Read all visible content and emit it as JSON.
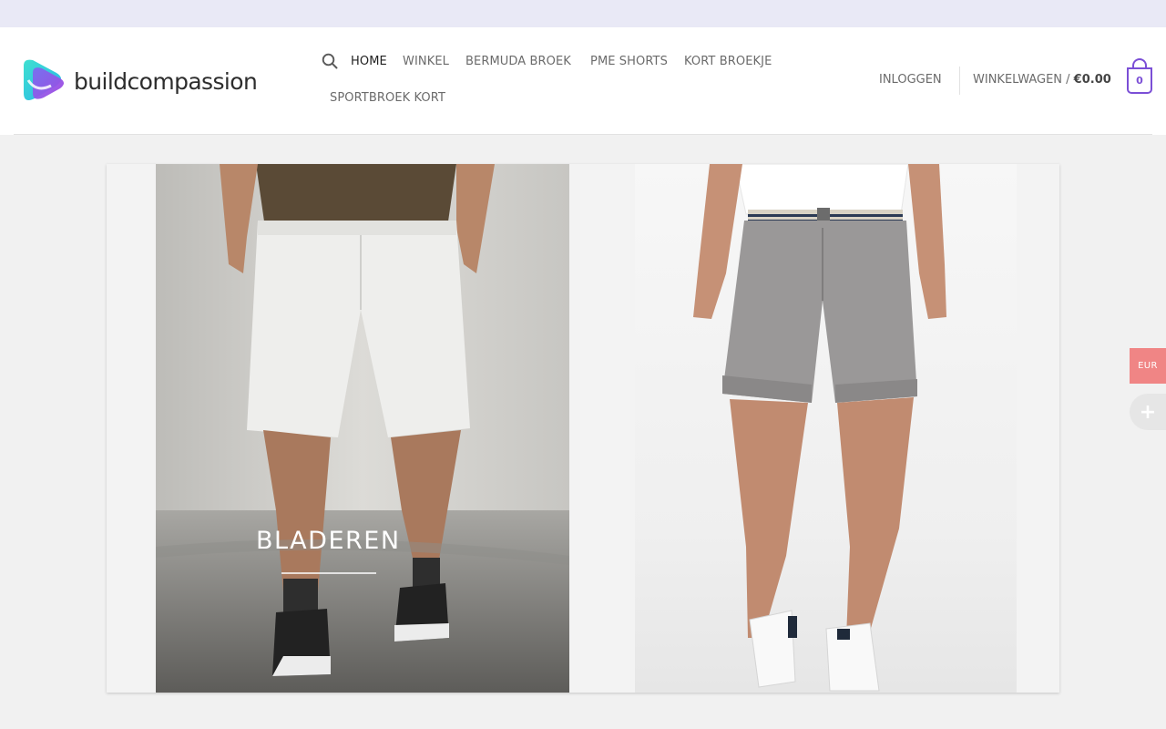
{
  "brand": {
    "name": "buildcompassion"
  },
  "nav": {
    "items": [
      {
        "label": "HOME",
        "active": true
      },
      {
        "label": "WINKEL"
      },
      {
        "label": "BERMUDA BROEK"
      },
      {
        "label": "PME SHORTS"
      },
      {
        "label": "KORT BROEKJE"
      },
      {
        "label": "SPORTBROEK KORT"
      }
    ]
  },
  "account": {
    "login_label": "INLOGGEN"
  },
  "cart": {
    "label": "WINKELWAGEN / ",
    "total": "€0.00",
    "count": "0"
  },
  "hero": {
    "button_label": "BLADEREN",
    "left_image": "man-white-bermuda-shorts",
    "right_image": "man-grey-chino-shorts"
  },
  "currency": {
    "label": "EUR"
  },
  "colors": {
    "accent": "#7b4fd6",
    "currency_bg": "#f08585",
    "topbar": "#e9e9f6"
  }
}
